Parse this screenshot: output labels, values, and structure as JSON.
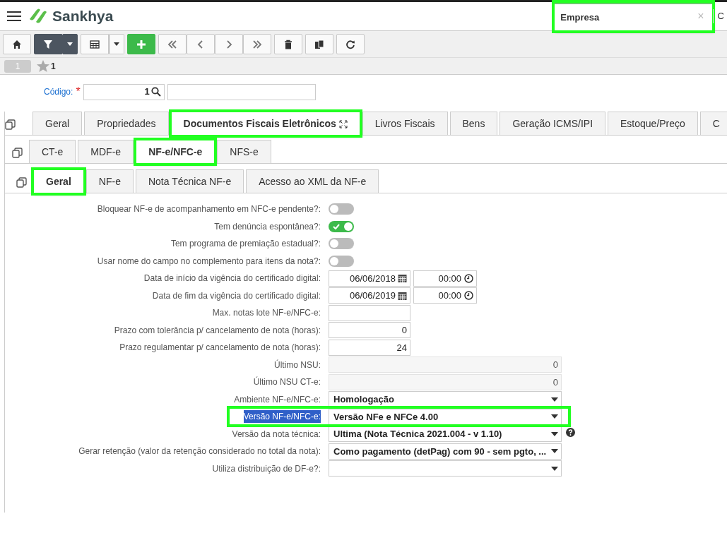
{
  "app": {
    "brand": "Sankhya",
    "tab_title": "Empresa",
    "tab_title_highlighted": true,
    "close_glyph": "×",
    "next_tab": "C"
  },
  "toolbar": {
    "buttons": [
      {
        "kind": "home"
      },
      {
        "kind": "filter",
        "dropdown": true,
        "dark": true
      },
      {
        "kind": "grid",
        "dropdown": true
      },
      {
        "kind": "add"
      },
      {
        "kind": "first"
      },
      {
        "kind": "prev"
      },
      {
        "kind": "next"
      },
      {
        "kind": "last"
      },
      {
        "kind": "delete"
      },
      {
        "kind": "copy"
      },
      {
        "kind": "refresh"
      }
    ]
  },
  "record_bar": {
    "page": "1",
    "favorite_count": "1"
  },
  "code_field": {
    "label": "Código:",
    "required_mark": "*",
    "value": "1"
  },
  "main_tabs": [
    {
      "label": "Geral",
      "selected": false,
      "highlighted": false
    },
    {
      "label": "Propriedades",
      "selected": false,
      "highlighted": false
    },
    {
      "label": "Documentos Fiscais Eletrônicos",
      "selected": true,
      "highlighted": true
    },
    {
      "label": "Livros Fiscais",
      "selected": false,
      "highlighted": false
    },
    {
      "label": "Bens",
      "selected": false,
      "highlighted": false
    },
    {
      "label": "Geração ICMS/IPI",
      "selected": false,
      "highlighted": false
    },
    {
      "label": "Estoque/Preço",
      "selected": false,
      "highlighted": false
    },
    {
      "label": "C",
      "selected": false,
      "highlighted": false
    }
  ],
  "doc_tabs": [
    {
      "label": "CT-e",
      "selected": false,
      "highlighted": false
    },
    {
      "label": "MDF-e",
      "selected": false,
      "highlighted": false
    },
    {
      "label": "NF-e/NFC-e",
      "selected": true,
      "highlighted": true
    },
    {
      "label": "NFS-e",
      "selected": false,
      "highlighted": false
    }
  ],
  "section_tabs": [
    {
      "label": "Geral",
      "selected": true,
      "highlighted": true
    },
    {
      "label": "NF-e",
      "selected": false,
      "highlighted": false
    },
    {
      "label": "Nota Técnica NF-e",
      "selected": false,
      "highlighted": false
    },
    {
      "label": "Acesso ao XML da NF-e",
      "selected": false,
      "highlighted": false
    }
  ],
  "fields": [
    {
      "kind": "toggle",
      "label": "Bloquear NF-e de acompanhamento em NFC-e pendente?:",
      "on": false
    },
    {
      "kind": "toggle",
      "label": "Tem denúncia espontânea?:",
      "on": true
    },
    {
      "kind": "toggle",
      "label": "Tem programa de premiação estadual?:",
      "on": false
    },
    {
      "kind": "toggle",
      "label": "Usar nome do campo no complemento para itens da nota?:",
      "on": false
    },
    {
      "kind": "datetime",
      "label": "Data de início da vigência do certificado digital:",
      "date": "06/06/2018",
      "time": "00:00"
    },
    {
      "kind": "datetime",
      "label": "Data de fim da vigência do certificado digital:",
      "date": "06/06/2019",
      "time": "00:00"
    },
    {
      "kind": "number",
      "label": "Max. notas lote NF-e/NFC-e:"
    },
    {
      "kind": "number",
      "label": "Prazo com tolerância p/ cancelamento de nota (horas):",
      "value": "0"
    },
    {
      "kind": "number",
      "label": "Prazo regulamentar p/ cancelamento de nota (horas):",
      "value": "24"
    },
    {
      "kind": "readonly",
      "label": "Último NSU:",
      "value": "0"
    },
    {
      "kind": "readonly",
      "label": "Último NSU CT-e:",
      "value": "0"
    },
    {
      "kind": "select",
      "label": "Ambiente NF-e/NFC-e:",
      "value": "Homologação"
    },
    {
      "kind": "select",
      "label": "Versão NF-e/NFC-e:",
      "value": "Versão NFe e NFCe 4.00",
      "label_selected": true,
      "highlighted": true
    },
    {
      "kind": "select",
      "label": "Versão da nota técnica:",
      "value": "Ultima (Nota Técnica 2021.004 - v 1.10)",
      "help": true
    },
    {
      "kind": "select",
      "label": "Gerar retenção (valor da retenção considerado no total da nota):",
      "value": "Como pagamento (detPag) com 90 - sem pgto, ..."
    },
    {
      "kind": "select",
      "label": "Utiliza distribuição de DF-e?:"
    }
  ]
}
